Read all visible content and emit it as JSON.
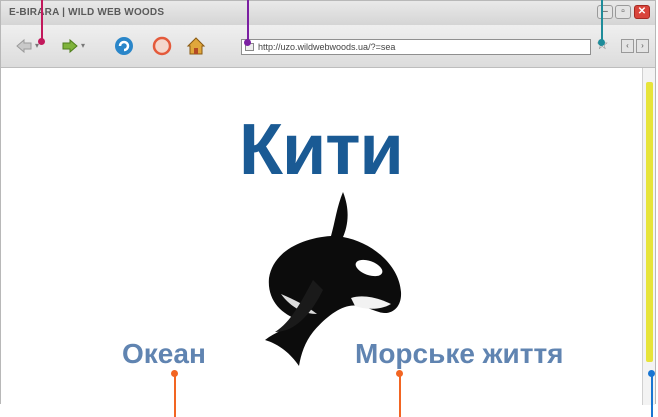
{
  "window": {
    "title": "E-BIRARA | WILD WEB WOODS"
  },
  "toolbar": {
    "address_url": "http://uzo.wildwebwoods.ua/?=sea",
    "bookmark_icon": "star-icon",
    "back_icon": "back-arrow-icon",
    "forward_icon": "forward-arrow-icon",
    "refresh_icon": "refresh-icon",
    "stop_icon": "stop-icon",
    "home_icon": "home-icon"
  },
  "page": {
    "headline": "Кити",
    "link_ocean": "Океан",
    "link_sea_life": "Морське життя"
  },
  "colors": {
    "headline": "#1a5a94",
    "links": "#6084b1",
    "callout_magenta": "#c2185b",
    "callout_purple": "#7b1fa2",
    "callout_teal": "#1e8c9a",
    "callout_orange": "#f26522",
    "callout_blue": "#1976d2",
    "scroll_thumb": "#e7e43a"
  }
}
